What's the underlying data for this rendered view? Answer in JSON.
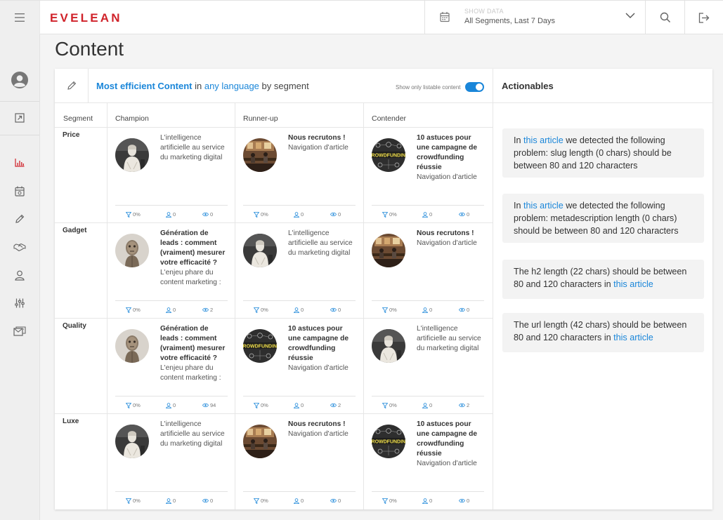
{
  "header": {
    "logo": "EVELEAN",
    "show_data_label": "SHOW DATA",
    "show_data_value": "All Segments, Last 7 Days"
  },
  "page": {
    "title": "Content"
  },
  "panel": {
    "headline": {
      "part1": "Most efficient Content",
      "part2": " in ",
      "part3": "any language",
      "part4": " by segment"
    },
    "toggle_label": "Show only listable content",
    "toggle_on": true,
    "columns": [
      "Segment",
      "Champion",
      "Runner-up",
      "Contender"
    ],
    "rows": [
      {
        "segment": "Price",
        "cells": [
          {
            "image": "statue",
            "title": "",
            "desc": "L'intelligence artificielle au service du marketing digital",
            "filter": "0%",
            "users": "0",
            "views": "0"
          },
          {
            "image": "office",
            "title": "Nous recrutons !",
            "desc": "Navigation d'article",
            "filter": "0%",
            "users": "0",
            "views": "0"
          },
          {
            "image": "crowdfunding",
            "title": "10 astuces pour une campagne de crowdfunding réussie",
            "desc": "Navigation d'article",
            "filter": "0%",
            "users": "0",
            "views": "0"
          }
        ]
      },
      {
        "segment": "Gadget",
        "cells": [
          {
            "image": "robot",
            "title": "Génération de leads : comment (vraiment) mesurer votre efficacité ?",
            "desc": "L'enjeu phare du content marketing :",
            "filter": "0%",
            "users": "0",
            "views": "2"
          },
          {
            "image": "statue",
            "title": "",
            "desc": "L'intelligence artificielle au service du marketing digital",
            "filter": "0%",
            "users": "0",
            "views": "0"
          },
          {
            "image": "office",
            "title": "Nous recrutons !",
            "desc": "Navigation d'article",
            "filter": "0%",
            "users": "0",
            "views": "0"
          }
        ]
      },
      {
        "segment": "Quality",
        "cells": [
          {
            "image": "robot",
            "title": "Génération de leads : comment (vraiment) mesurer votre efficacité ?",
            "desc": "L'enjeu phare du content marketing :",
            "filter": "0%",
            "users": "0",
            "views": "94"
          },
          {
            "image": "crowdfunding",
            "title": "10 astuces pour une campagne de crowdfunding réussie",
            "desc": "Navigation d'article",
            "filter": "0%",
            "users": "0",
            "views": "2"
          },
          {
            "image": "statue",
            "title": "",
            "desc": "L'intelligence artificielle au service du marketing digital",
            "filter": "0%",
            "users": "0",
            "views": "2"
          }
        ]
      },
      {
        "segment": "Luxe",
        "cells": [
          {
            "image": "statue",
            "title": "",
            "desc": "L'intelligence artificielle au service du marketing digital",
            "filter": "0%",
            "users": "0",
            "views": "0"
          },
          {
            "image": "office",
            "title": "Nous recrutons !",
            "desc": "Navigation d'article",
            "filter": "0%",
            "users": "0",
            "views": "0"
          },
          {
            "image": "crowdfunding",
            "title": "10 astuces pour une campagne de crowdfunding réussie",
            "desc": "Navigation d'article",
            "filter": "0%",
            "users": "0",
            "views": "0"
          }
        ]
      }
    ]
  },
  "actionables": {
    "title": "Actionables",
    "items": [
      {
        "pre": "In ",
        "link": "this article",
        "post": " we detected the following problem: slug length (0 chars) should be between 80 and 120 characters"
      },
      {
        "pre": "In ",
        "link": "this article",
        "post": " we detected the following problem: metadescription length (0 chars) should be between 80 and 120 characters"
      },
      {
        "pre": "The h2 length (22 chars) should be between 80 and 120 characters in ",
        "link": "this article",
        "post": ""
      },
      {
        "pre": "The url length (42 chars) should be between 80 and 120 characters in ",
        "link": "this article",
        "post": ""
      }
    ]
  },
  "colors": {
    "brand": "#d0222a",
    "accent": "#1a86d9"
  },
  "icons": {
    "sidebar": [
      "avatar-icon",
      "external-link-icon",
      "chart-icon",
      "calendar-icon",
      "pencil-icon",
      "handshake-icon",
      "user-icon",
      "sliders-icon",
      "mail-icon"
    ],
    "stats": [
      "filter-icon",
      "user-icon",
      "eye-icon"
    ]
  }
}
